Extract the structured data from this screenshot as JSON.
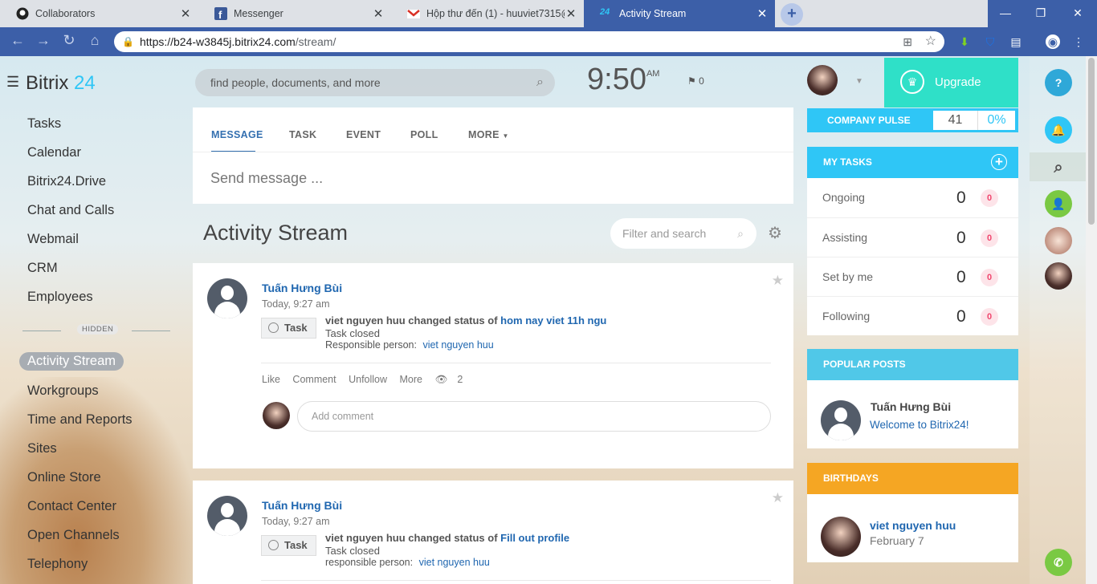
{
  "browser": {
    "tabs": [
      {
        "title": "Collaborators",
        "icon": "github-icon"
      },
      {
        "title": "Messenger",
        "icon": "facebook-icon"
      },
      {
        "title": "Hộp thư đến (1) - huuviet7315@",
        "icon": "gmail-icon"
      },
      {
        "title": "Activity Stream",
        "icon": "bitrix24-icon"
      }
    ],
    "url_domain": "https://b24-w3845j.bitrix24.com",
    "url_path": "/stream/"
  },
  "sidebar": {
    "logo_text": "Bitrix",
    "logo_num": "24",
    "items": [
      "Tasks",
      "Calendar",
      "Bitrix24.Drive",
      "Chat and Calls",
      "Webmail",
      "CRM",
      "Employees"
    ],
    "hidden_label": "HIDDEN",
    "active_item": "Activity Stream",
    "items2": [
      "Workgroups",
      "Time and Reports",
      "Sites",
      "Online Store",
      "Contact Center",
      "Open Channels",
      "Telephony"
    ]
  },
  "header": {
    "search_placeholder": "find people, documents, and more",
    "time": "9:50",
    "ampm": "AM",
    "flag_count": "0",
    "upgrade": "Upgrade"
  },
  "composer": {
    "tabs": [
      "MESSAGE",
      "TASK",
      "EVENT",
      "POLL",
      "MORE"
    ],
    "placeholder": "Send message ..."
  },
  "stream": {
    "title": "Activity Stream",
    "filter_placeholder": "Filter and search",
    "posts": [
      {
        "author": "Tuấn Hưng Bùi",
        "time": "Today, 9:27 am",
        "tag": "Task",
        "actor": "viet nguyen huu",
        "action": "changed status of",
        "task": "hom nay viet 11h ngu",
        "status": "Task closed",
        "resp_label": "Responsible person:",
        "resp_name": "viet nguyen huu",
        "like": "Like",
        "comment": "Comment",
        "unfollow": "Unfollow",
        "more": "More",
        "views": "2",
        "comment_placeholder": "Add comment"
      },
      {
        "author": "Tuấn Hưng Bùi",
        "time": "Today, 9:27 am",
        "tag": "Task",
        "actor": "viet nguyen huu",
        "action": "changed status of",
        "task": "Fill out profile",
        "status": "Task closed",
        "resp_label": "responsible person:",
        "resp_name": "viet nguyen huu"
      }
    ]
  },
  "right": {
    "pulse_label": "COMPANY PULSE",
    "pulse_value": "41",
    "pulse_percent": "0%",
    "tasks_title": "MY TASKS",
    "tasks": [
      {
        "label": "Ongoing",
        "count": "0",
        "badge": "0"
      },
      {
        "label": "Assisting",
        "count": "0",
        "badge": "0"
      },
      {
        "label": "Set by me",
        "count": "0",
        "badge": "0"
      },
      {
        "label": "Following",
        "count": "0",
        "badge": "0"
      }
    ],
    "popular_title": "POPULAR POSTS",
    "popular_author": "Tuấn Hưng Bùi",
    "popular_post": "Welcome to Bitrix24!",
    "birthdays_title": "BIRTHDAYS",
    "birthday_name": "viet nguyen huu",
    "birthday_date": "February 7"
  },
  "colors": {
    "accent": "#2fc6f6",
    "upgrade": "#2fe0c8",
    "birthdays": "#f5a623",
    "browser": "#3c5fa8"
  }
}
